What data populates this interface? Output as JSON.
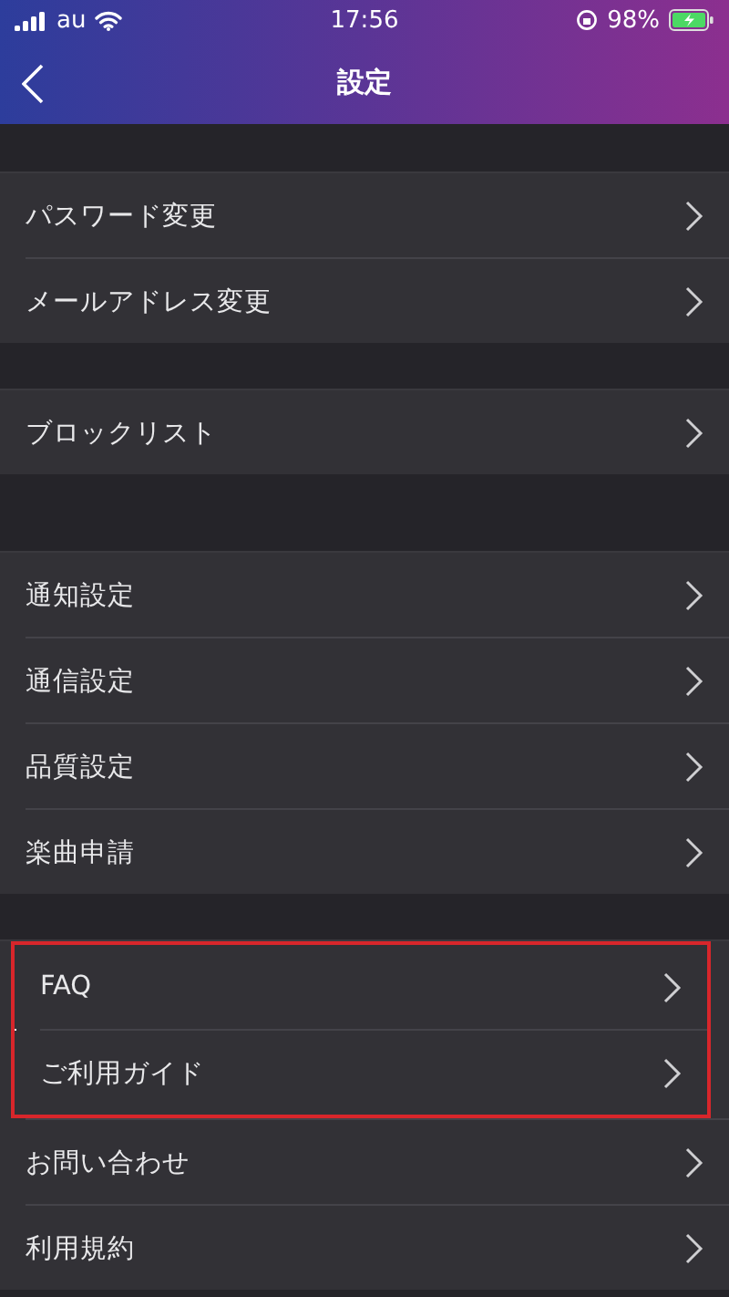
{
  "status_bar": {
    "carrier": "au",
    "time": "17:56",
    "battery": "98%"
  },
  "nav": {
    "title": "設定"
  },
  "sections": [
    {
      "items": [
        {
          "label": "パスワード変更",
          "highlighted": false
        },
        {
          "label": "メールアドレス変更",
          "highlighted": false
        }
      ]
    },
    {
      "items": [
        {
          "label": "ブロックリスト",
          "highlighted": false
        }
      ]
    },
    {
      "items": [
        {
          "label": "通知設定",
          "highlighted": false
        },
        {
          "label": "通信設定",
          "highlighted": false
        },
        {
          "label": "品質設定",
          "highlighted": false
        },
        {
          "label": "楽曲申請",
          "highlighted": false
        }
      ]
    },
    {
      "items": [
        {
          "label": "FAQ",
          "highlighted": true
        },
        {
          "label": "ご利用ガイド",
          "highlighted": true
        },
        {
          "label": "お問い合わせ",
          "highlighted": false
        },
        {
          "label": "利用規約",
          "highlighted": false
        }
      ]
    }
  ]
}
